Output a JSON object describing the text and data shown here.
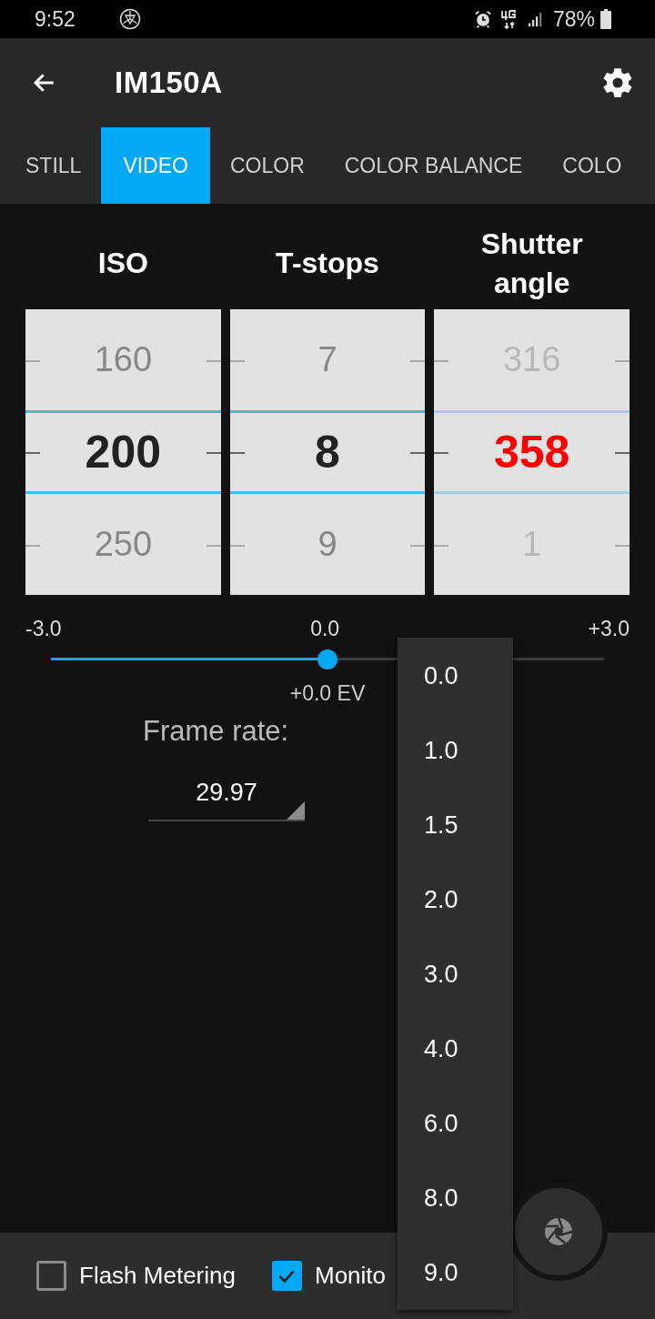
{
  "status_bar": {
    "time": "9:52",
    "battery": "78%"
  },
  "app_bar": {
    "title": "IM150A"
  },
  "tabs": [
    {
      "label": "STILL",
      "selected": false
    },
    {
      "label": "VIDEO",
      "selected": true
    },
    {
      "label": "COLOR",
      "selected": false
    },
    {
      "label": "COLOR BALANCE",
      "selected": false
    },
    {
      "label": "COLO",
      "selected": false
    }
  ],
  "wheels": [
    {
      "title": "ISO",
      "above": "160",
      "value": "200",
      "below": "250",
      "dimmed": false,
      "warning": false
    },
    {
      "title": "T-stops",
      "above": "7",
      "value": "8",
      "below": "9",
      "dimmed": false,
      "warning": false
    },
    {
      "title": "Shutter angle",
      "above": "316",
      "value": "358",
      "below": "1",
      "dimmed": true,
      "warning": true
    }
  ],
  "ev_slider": {
    "min_label": "-3.0",
    "mid_label": "0.0",
    "max_label": "+3.0",
    "level": 0.5,
    "reading": "+0.0 EV"
  },
  "frame_rate": {
    "label": "Frame rate:",
    "value": "29.97"
  },
  "dropdown_menu": {
    "items": [
      "0.0",
      "1.0",
      "1.5",
      "2.0",
      "3.0",
      "4.0",
      "6.0",
      "8.0",
      "9.0"
    ]
  },
  "bottom_bar": {
    "checkboxes": [
      {
        "label": "Flash Metering",
        "checked": false
      },
      {
        "label": "Monito",
        "checked": true
      }
    ]
  }
}
